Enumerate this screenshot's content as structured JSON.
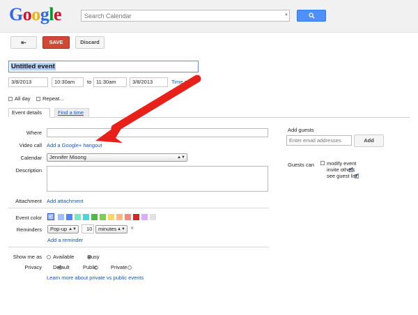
{
  "header": {
    "logo_letters": [
      {
        "ch": "G",
        "color": "#3369e8"
      },
      {
        "ch": "o",
        "color": "#d50f25"
      },
      {
        "ch": "o",
        "color": "#eeb211"
      },
      {
        "ch": "g",
        "color": "#3369e8"
      },
      {
        "ch": "l",
        "color": "#009925"
      },
      {
        "ch": "e",
        "color": "#d50f25"
      }
    ],
    "search_placeholder": "Search Calendar",
    "search_button_icon": "search-icon"
  },
  "toolbar": {
    "back_icon": "⇤",
    "save_label": "SAVE",
    "discard_label": "Discard"
  },
  "event": {
    "title": "Untitled event",
    "start_date": "3/8/2013",
    "start_time": "10:30am",
    "to_label": "to",
    "end_time": "11:30am",
    "end_date": "3/8/2013",
    "timezone_link": "Time z",
    "all_day_label": "All day",
    "repeat_label": "Repeat..."
  },
  "tabs": {
    "event_details": "Event details",
    "find_a_time": "Find a time"
  },
  "details": {
    "where_label": "Where",
    "video_call_label": "Video call",
    "hangout_link": "Add a Google+ hangout",
    "calendar_label": "Calendar",
    "calendar_value": "Jennifer Misong",
    "description_label": "Description",
    "attachment_label": "Attachment",
    "attachment_link": "Add attachment",
    "event_color_label": "Event color",
    "colors": [
      "#a4bdfc",
      "#5484ed",
      "#7ae7bf",
      "#46d6db",
      "#51b749",
      "#7bd148",
      "#fbd75b",
      "#ffb878",
      "#ff887c",
      "#dc2127",
      "#dbadff",
      "#e1e1e1"
    ],
    "reminders_label": "Reminders",
    "reminder_type": "Pop-up",
    "reminder_value": "10",
    "reminder_unit": "minutes",
    "remove_reminder": "×",
    "add_reminder_link": "Add a reminder",
    "show_me_as_label": "Show me as",
    "available_label": "Available",
    "busy_label": "Busy",
    "privacy_label": "Privacy",
    "default_label": "Default",
    "public_label": "Public",
    "private_label": "Private",
    "privacy_learn_link": "Learn more about private vs public events"
  },
  "guests": {
    "add_guests_label": "Add guests",
    "email_placeholder": "Enter email addresses",
    "add_button": "Add",
    "guests_can_label": "Guests can",
    "modify_event": "modify event",
    "invite_others": "invite others",
    "see_guest_list": "see guest list"
  },
  "annotation": {
    "arrow_color": "#e8201a"
  }
}
